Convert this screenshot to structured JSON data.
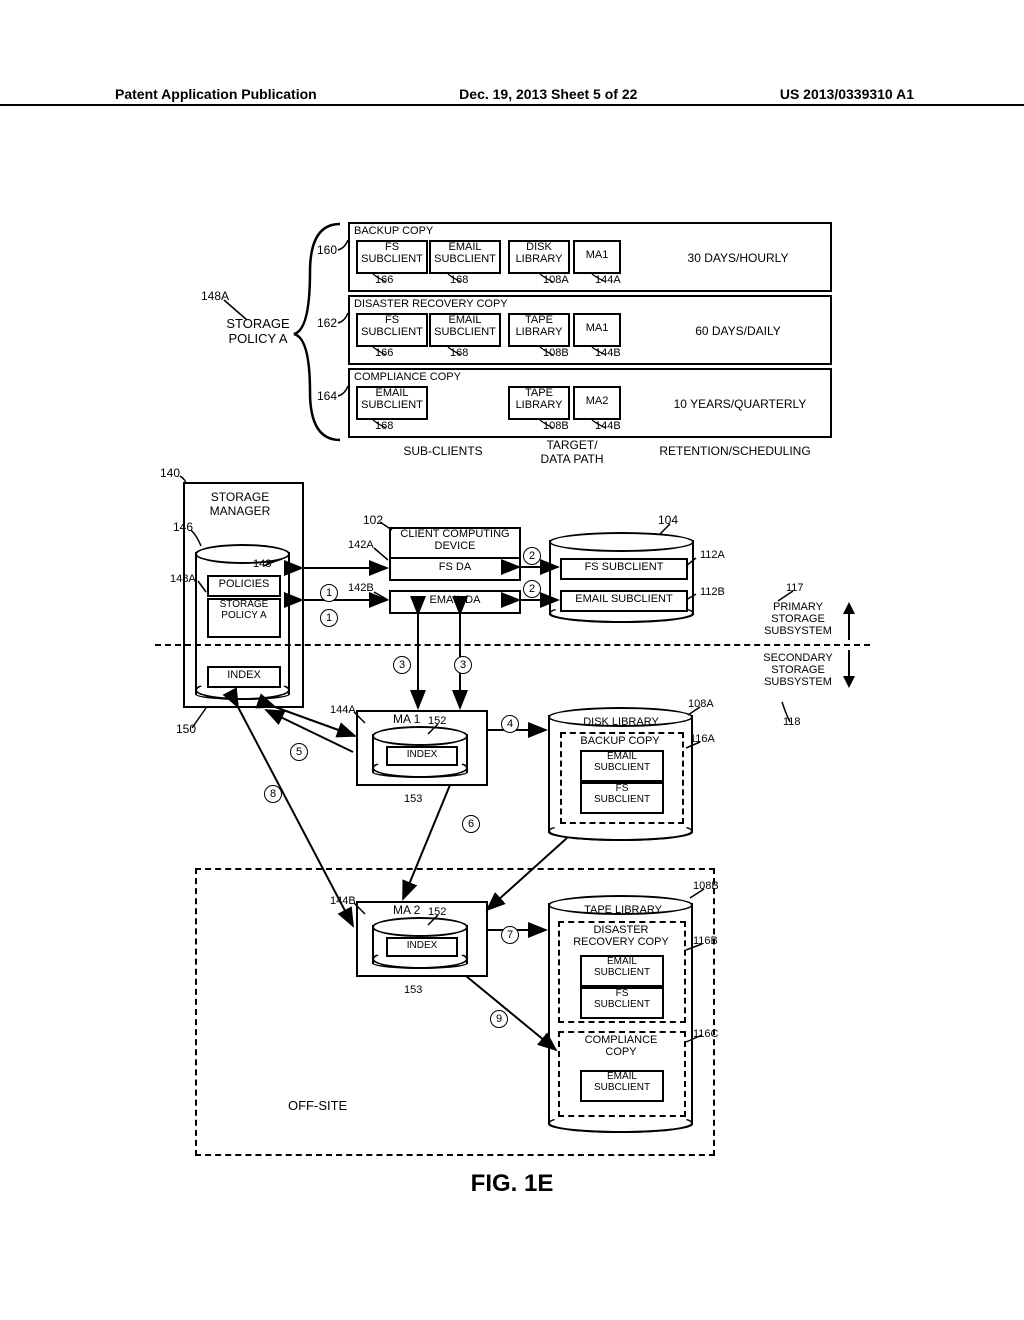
{
  "header": {
    "left": "Patent Application Publication",
    "center": "Dec. 19, 2013  Sheet 5 of 22",
    "right": "US 2013/0339310 A1"
  },
  "figure_label": "FIG. 1E",
  "policy_title": "STORAGE POLICY A",
  "ref_148A_top": "148A",
  "columns": {
    "subclients": "SUB-CLIENTS",
    "target": "TARGET/\nDATA PATH",
    "retention": "RETENTION/SCHEDULING"
  },
  "rows": {
    "backup": {
      "title": "BACKUP COPY",
      "ref": "160",
      "cells": {
        "fs": "FS\nSUBCLIENT",
        "email": "EMAIL\nSUBCLIENT",
        "lib": "DISK\nLIBRARY",
        "ma": "MA1"
      },
      "refs": {
        "a166": "166",
        "a168": "168",
        "a108A": "108A",
        "a144A": "144A"
      },
      "ret": "30 DAYS/HOURLY"
    },
    "dr": {
      "title": "DISASTER RECOVERY COPY",
      "ref": "162",
      "cells": {
        "fs": "FS\nSUBCLIENT",
        "email": "EMAIL\nSUBCLIENT",
        "lib": "TAPE\nLIBRARY",
        "ma": "MA1"
      },
      "refs": {
        "a166": "166",
        "a168": "168",
        "a108B": "108B",
        "a144B": "144B"
      },
      "ret": "60 DAYS/DAILY"
    },
    "comp": {
      "title": "COMPLIANCE COPY",
      "ref": "164",
      "cells": {
        "email": "EMAIL\nSUBCLIENT",
        "lib": "TAPE\nLIBRARY",
        "ma": "MA2"
      },
      "refs": {
        "a168": "168",
        "a108B": "108B",
        "a144B": "144B"
      },
      "ret": "10 YEARS/QUARTERLY"
    }
  },
  "ref_140": "140",
  "storage_manager": "STORAGE\nMANAGER",
  "ref_146": "146",
  "policies_label": "POLICIES",
  "storage_policy_a": "STORAGE\nPOLICY A",
  "index_label": "INDEX",
  "ref_148A": "148A",
  "ref_148": "148",
  "ref_150": "150",
  "ref_102": "102",
  "client_device": "CLIENT COMPUTING\nDEVICE",
  "ref_142A": "142A",
  "ref_142B": "142B",
  "fs_da": "FS DA",
  "email_da": "EMAIL DA",
  "ref_104": "104",
  "fs_subclient": "FS SUBCLIENT",
  "email_subclient": "EMAIL SUBCLIENT",
  "ref_112A": "112A",
  "ref_112B": "112B",
  "ref_117": "117",
  "primary_sub": "PRIMARY\nSTORAGE\nSUBSYSTEM",
  "secondary_sub": "SECONDARY\nSTORAGE\nSUBSYSTEM",
  "ref_118": "118",
  "ma1": "MA 1",
  "ma2": "MA 2",
  "ref_144A_b": "144A",
  "ref_144B_b": "144B",
  "ref_152a": "152",
  "ref_152b": "152",
  "ref_153a": "153",
  "ref_153b": "153",
  "ref_108A_b": "108A",
  "ref_108B_b": "108B",
  "disk_library": "DISK LIBRARY",
  "backup_copy": "BACKUP COPY",
  "email_sub_s": "EMAIL\nSUBCLIENT",
  "fs_sub_s": "FS\nSUBCLIENT",
  "ref_116A": "116A",
  "tape_library": "TAPE LIBRARY",
  "disaster_copy": "DISASTER\nRECOVERY COPY",
  "ref_116B": "116B",
  "compliance_copy": "COMPLIANCE\nCOPY",
  "ref_116C": "116C",
  "off_site": "OFF-SITE",
  "steps": {
    "s1": "1",
    "s1b": "1",
    "s2": "2",
    "s2b": "2",
    "s3": "3",
    "s3b": "3",
    "s4": "4",
    "s5": "5",
    "s6": "6",
    "s7": "7",
    "s8": "8",
    "s9": "9"
  }
}
